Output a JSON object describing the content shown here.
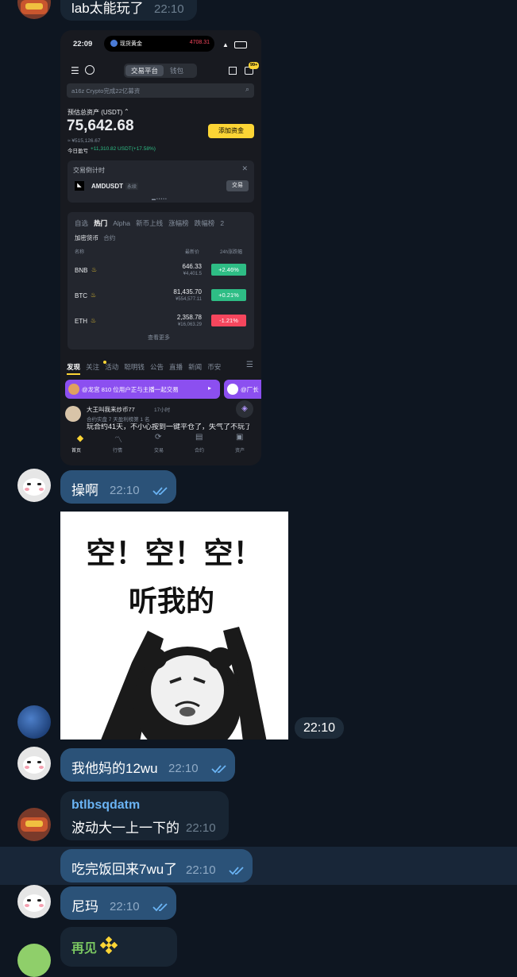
{
  "colors": {
    "bg": "#0e1621",
    "out_bubble": "#2b5278",
    "in_bubble": "#182533",
    "name_blue": "#6ab3f3",
    "name_green": "#7bc862",
    "read_check": "#6ab3f3",
    "binance_yellow": "#fcd535",
    "up_green": "#2ebd85",
    "down_red": "#f6465d"
  },
  "top_message": {
    "text": "lab太能玩了",
    "time": "22:10"
  },
  "phone": {
    "status_time": "22:09",
    "island_label": "现货黄金",
    "island_value": "4708.31",
    "tabs": [
      "交易平台",
      "钱包"
    ],
    "notif_count": "99+",
    "search_placeholder": "a16z Crypto完成22亿募资",
    "assets_label": "预估总资产 (USDT)",
    "assets_value": "75,642.68",
    "assets_cny": "≈ ¥515,126.67",
    "pnl_label": "今日盈亏",
    "pnl_value": "+11,310.82 USDT(+17.58%)",
    "add_funds": "添加资金",
    "countdown_title": "交易倒计时",
    "countdown_symbol": "AMDUSDT",
    "countdown_tag": "永续",
    "countdown_btn": "交易",
    "market_tabs": [
      "自选",
      "热门",
      "Alpha",
      "新币上线",
      "涨幅榜",
      "跌幅榜",
      "2"
    ],
    "sub_tabs": [
      "加密货币",
      "合约"
    ],
    "col_headers": [
      "名称",
      "最新价",
      "24h涨跌幅"
    ],
    "rows": [
      {
        "name": "BNB",
        "price": "646.33",
        "cny": "¥4,401.5",
        "change": "+2.46%",
        "up": true
      },
      {
        "name": "BTC",
        "price": "81,435.70",
        "cny": "¥554,577.11",
        "change": "+0.21%",
        "up": true
      },
      {
        "name": "ETH",
        "price": "2,358.78",
        "cny": "¥16,063.29",
        "change": "-1.21%",
        "up": false
      }
    ],
    "view_more": "查看更多",
    "feed_tabs": [
      "发现",
      "关注",
      "活动",
      "聪明钱",
      "公告",
      "直播",
      "新闻",
      "币安"
    ],
    "live_banner_1": "@龙宫 810 位用户正与主播一起交易",
    "live_banner_2": "@厂长",
    "post_author": "大王叫我来炒币77",
    "post_age": "17小时",
    "post_sub": "合约实盘 7 天盈利榜第 1 名",
    "post_text": "玩合约41天，不小心按到一键平仓了，失气了不玩了",
    "bottom_nav": [
      "首页",
      "行情",
      "交易",
      "合约",
      "资产"
    ]
  },
  "messages": [
    {
      "text": "操啊",
      "time": "22:10"
    },
    {
      "meme_line1": "空！空！空！",
      "meme_line2": "听我的",
      "time": "22:10"
    },
    {
      "text": "我他妈的12wu",
      "time": "22:10"
    },
    {
      "sender": "btlbsqdatm",
      "text": "波动大一上一下的",
      "time": "22:10"
    },
    {
      "text": "吃完饭回来7wu了",
      "time": "22:10"
    },
    {
      "text": "尼玛",
      "time": "22:10"
    },
    {
      "sender": "再见"
    }
  ]
}
